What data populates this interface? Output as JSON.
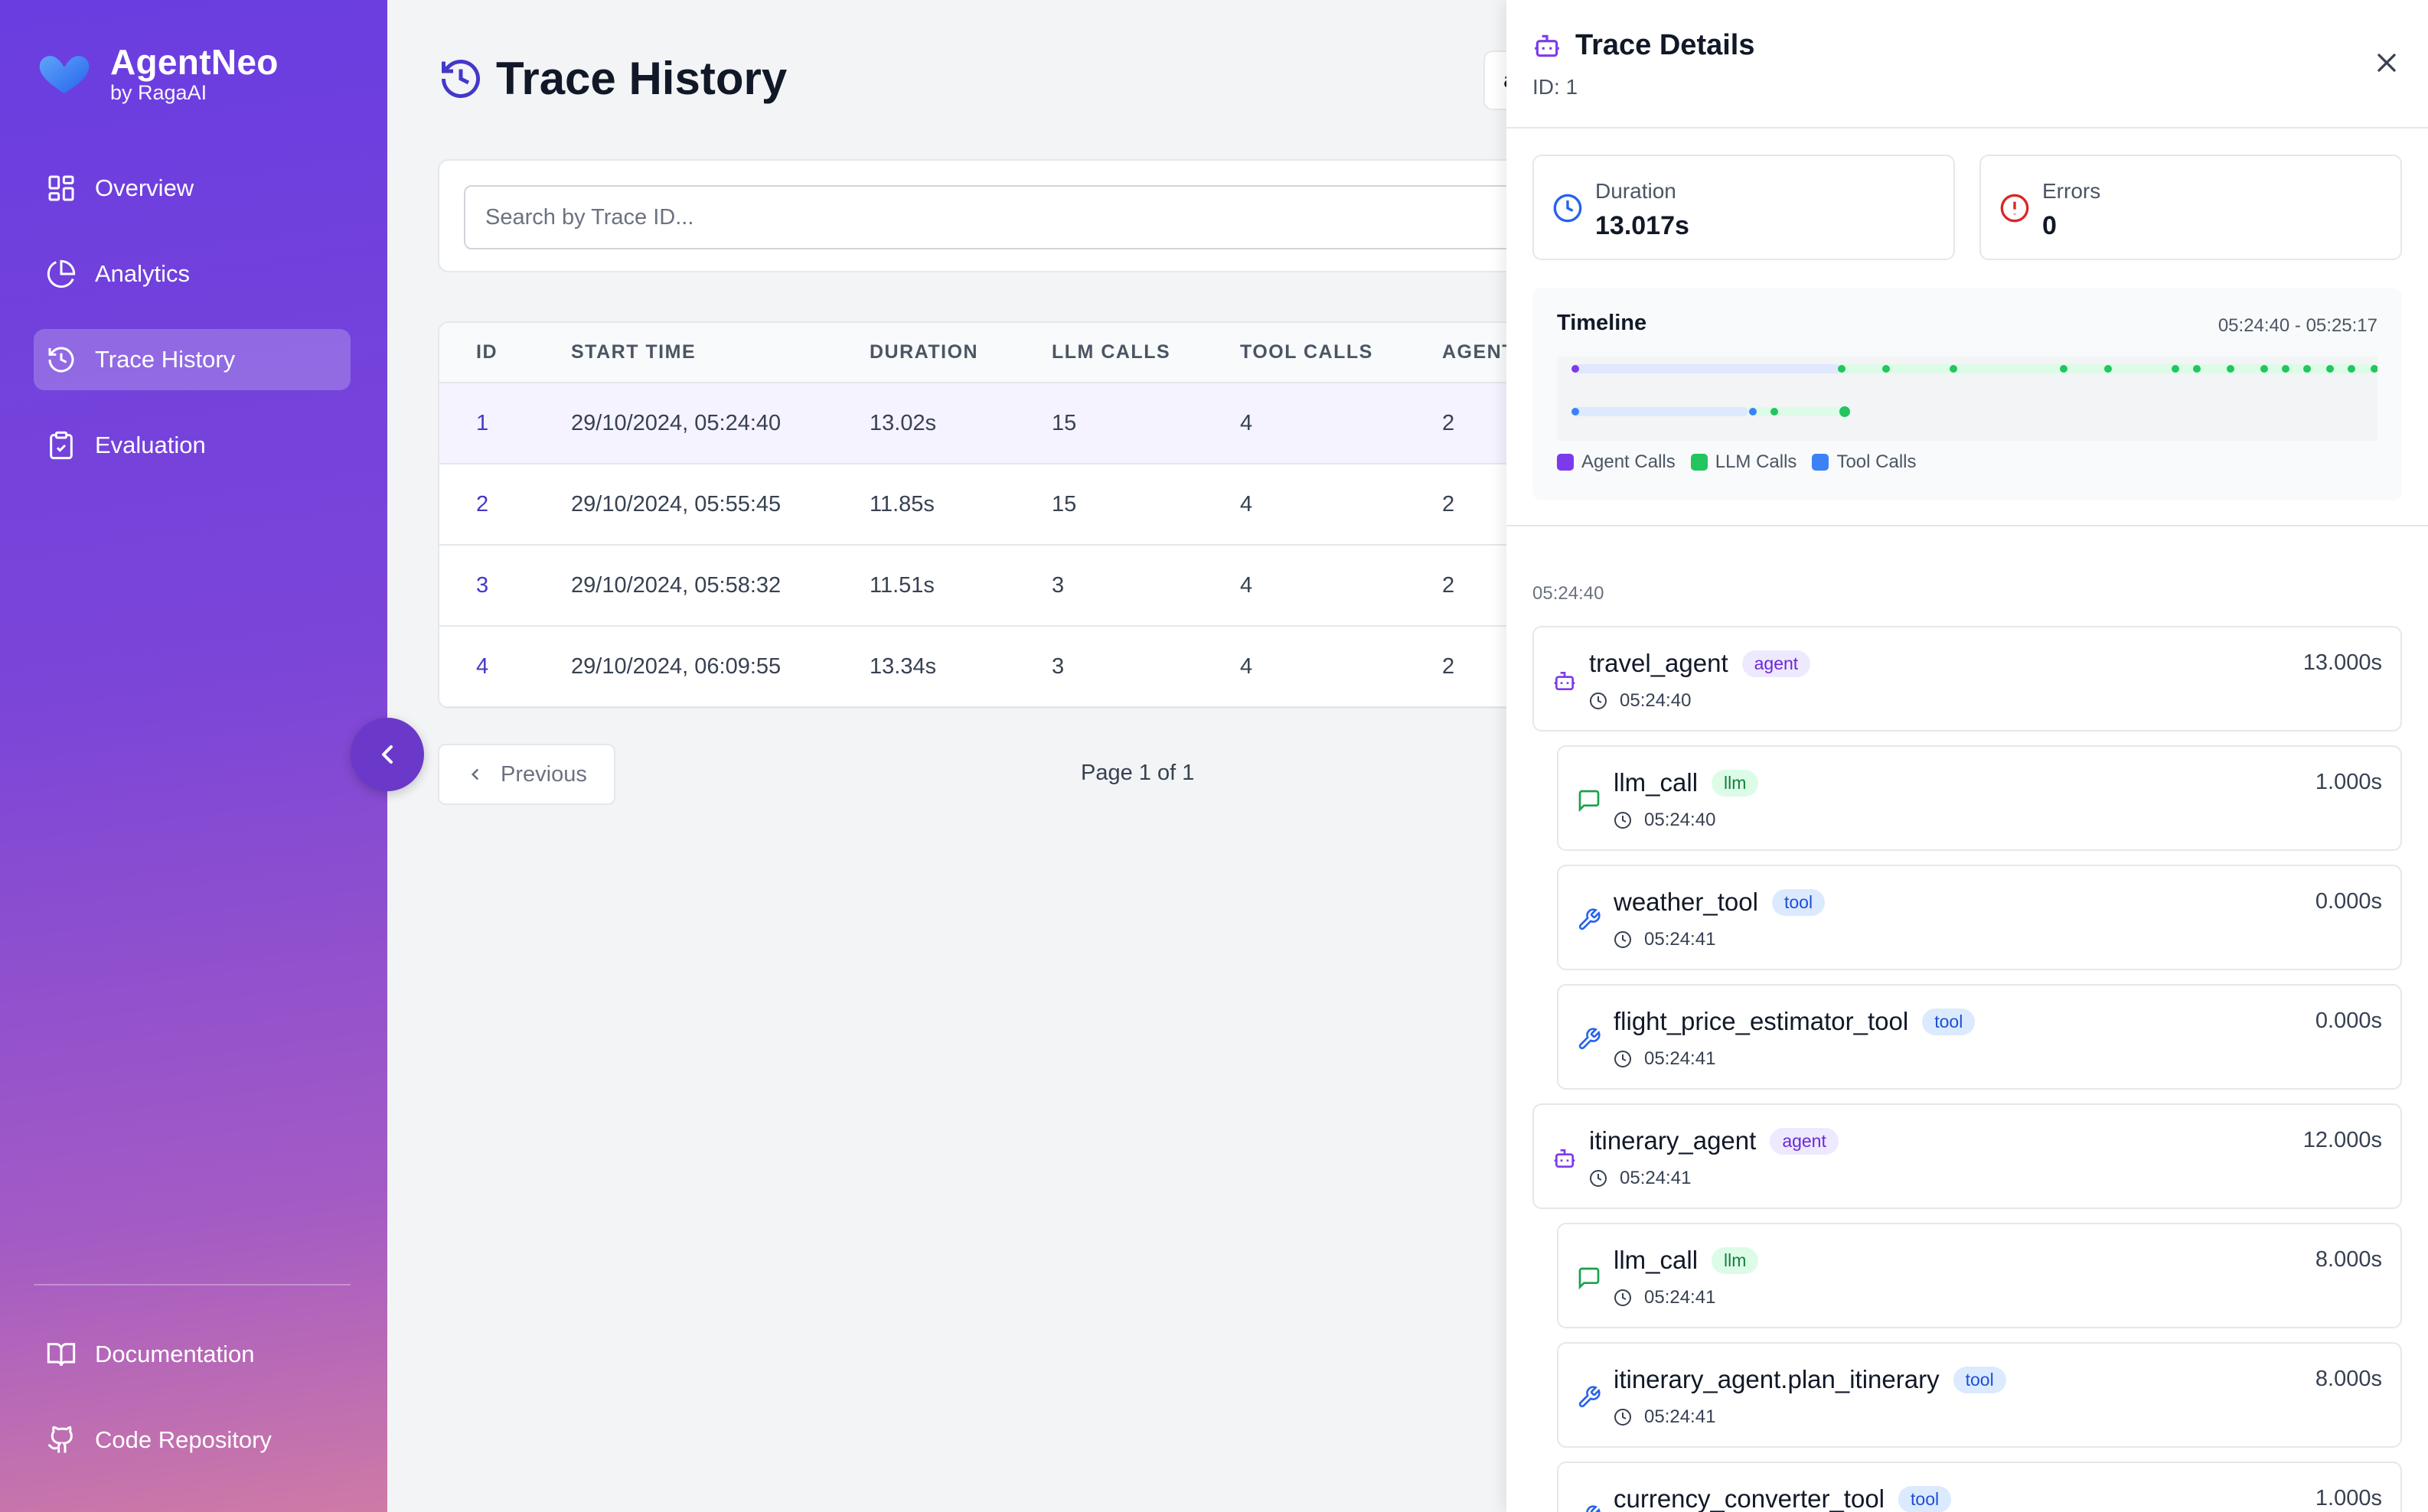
{
  "brand": {
    "name": "AgentNeo",
    "sub": "by RagaAI"
  },
  "sidebar": {
    "items": [
      {
        "label": "Overview",
        "icon": "grid-icon"
      },
      {
        "label": "Analytics",
        "icon": "pie-chart-icon"
      },
      {
        "label": "Trace History",
        "icon": "history-icon",
        "active": true
      },
      {
        "label": "Evaluation",
        "icon": "clipboard-icon"
      }
    ],
    "bottom": [
      {
        "label": "Documentation",
        "icon": "book-icon"
      },
      {
        "label": "Code Repository",
        "icon": "github-icon"
      }
    ]
  },
  "page": {
    "title": "Trace History",
    "search_placeholder": "Search by Trace ID...",
    "header_select_partial": "a"
  },
  "table": {
    "columns": [
      "ID",
      "START TIME",
      "DURATION",
      "LLM CALLS",
      "TOOL CALLS",
      "AGENT"
    ],
    "rows": [
      {
        "id": "1",
        "start": "29/10/2024, 05:24:40",
        "duration": "13.02s",
        "llm": "15",
        "tool": "4",
        "agent": "2"
      },
      {
        "id": "2",
        "start": "29/10/2024, 05:55:45",
        "duration": "11.85s",
        "llm": "15",
        "tool": "4",
        "agent": "2"
      },
      {
        "id": "3",
        "start": "29/10/2024, 05:58:32",
        "duration": "11.51s",
        "llm": "3",
        "tool": "4",
        "agent": "2"
      },
      {
        "id": "4",
        "start": "29/10/2024, 06:09:55",
        "duration": "13.34s",
        "llm": "3",
        "tool": "4",
        "agent": "2"
      }
    ]
  },
  "pagination": {
    "prev": "Previous",
    "page_text": "Page 1 of 1"
  },
  "panel": {
    "title": "Trace Details",
    "id_text": "ID: 1",
    "duration": {
      "label": "Duration",
      "value": "13.017s"
    },
    "errors": {
      "label": "Errors",
      "value": "0"
    },
    "timeline": {
      "title": "Timeline",
      "range": "05:24:40 - 05:25:17",
      "legend": [
        {
          "label": "Agent Calls",
          "color": "#7c3aed"
        },
        {
          "label": "LLM Calls",
          "color": "#22c55e"
        },
        {
          "label": "Tool Calls",
          "color": "#3b82f6"
        }
      ]
    },
    "section_time": "05:24:40",
    "calls": [
      {
        "name": "travel_agent",
        "type": "agent",
        "time": "05:24:40",
        "duration": "13.000s"
      },
      {
        "name": "llm_call",
        "type": "llm",
        "time": "05:24:40",
        "duration": "1.000s"
      },
      {
        "name": "weather_tool",
        "type": "tool",
        "time": "05:24:41",
        "duration": "0.000s"
      },
      {
        "name": "flight_price_estimator_tool",
        "type": "tool",
        "time": "05:24:41",
        "duration": "0.000s"
      },
      {
        "name": "itinerary_agent",
        "type": "agent",
        "time": "05:24:41",
        "duration": "12.000s"
      },
      {
        "name": "llm_call",
        "type": "llm",
        "time": "05:24:41",
        "duration": "8.000s"
      },
      {
        "name": "itinerary_agent.plan_itinerary",
        "type": "tool",
        "time": "05:24:41",
        "duration": "8.000s"
      },
      {
        "name": "currency_converter_tool",
        "type": "tool",
        "time": "",
        "duration": "1.000s"
      }
    ]
  }
}
